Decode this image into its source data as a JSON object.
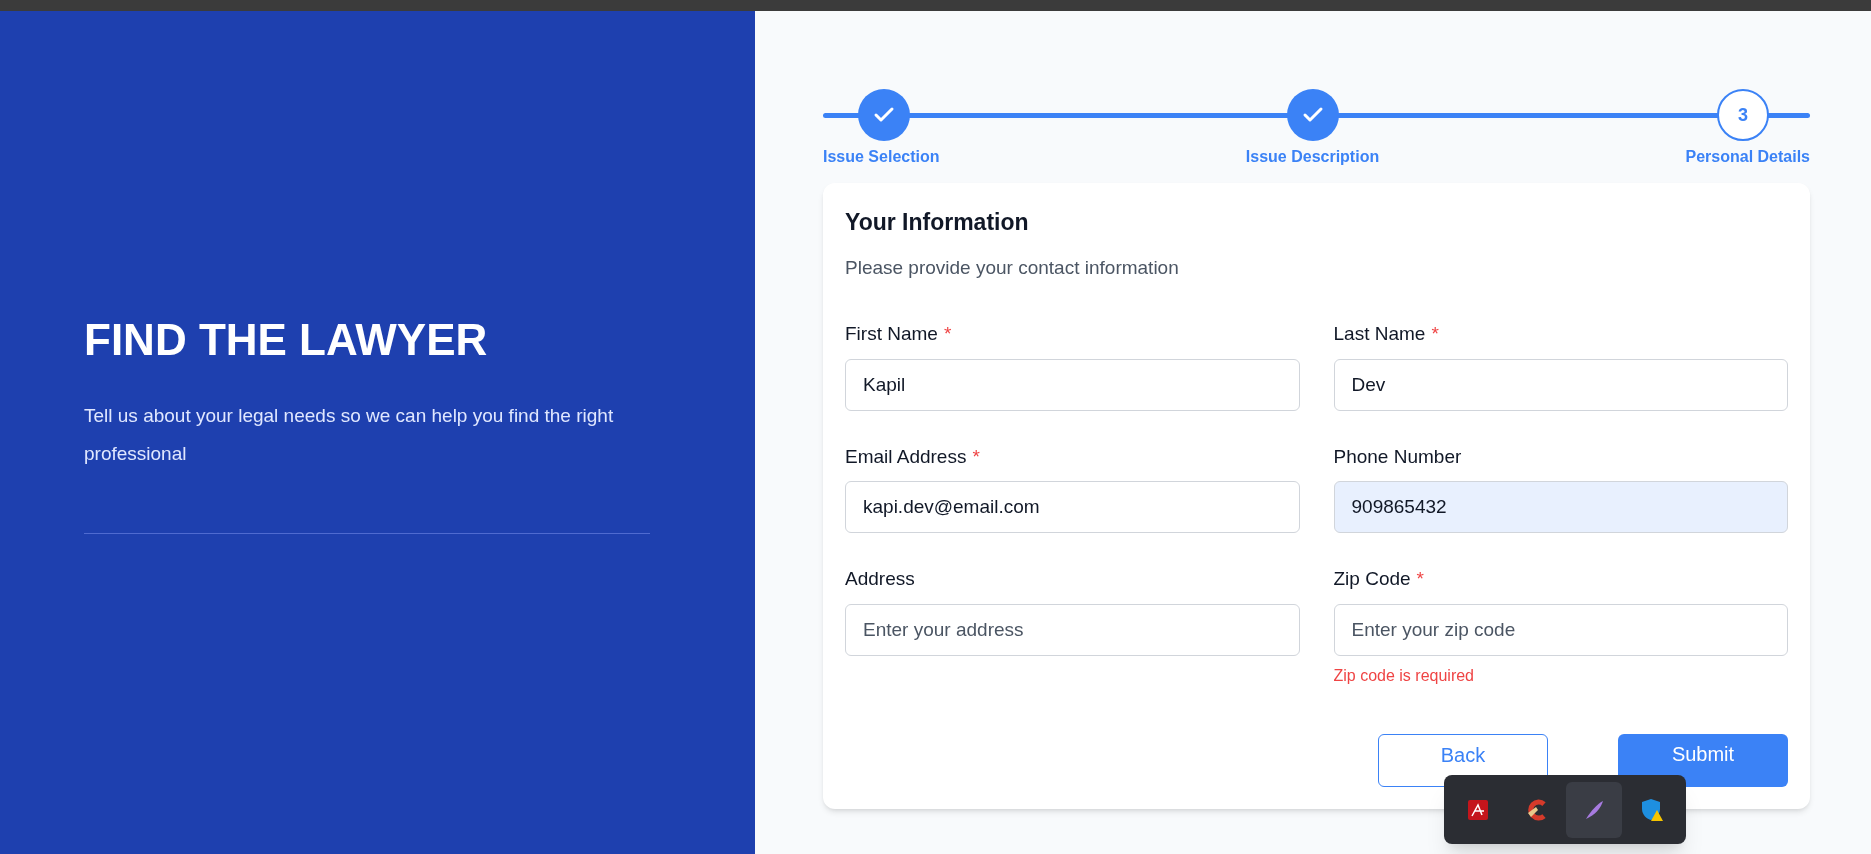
{
  "hero": {
    "title": "FIND THE LAWYER",
    "subtitle": "Tell us about your legal needs so we can help you find the right professional"
  },
  "steps": [
    {
      "label": "Issue Selection",
      "completed": true
    },
    {
      "label": "Issue Description",
      "completed": true
    },
    {
      "label": "Personal Details",
      "completed": false,
      "number": "3"
    }
  ],
  "form": {
    "title": "Your Information",
    "description": "Please provide your contact information",
    "fields": [
      {
        "label": "First Name",
        "required": true,
        "value": "Kapil",
        "autofilled": false
      },
      {
        "label": "Last Name",
        "required": true,
        "value": "Dev",
        "autofilled": false
      },
      {
        "label": "Email Address",
        "required": true,
        "value": "kapi.dev@email.com",
        "autofilled": false
      },
      {
        "label": "Phone Number",
        "required": false,
        "value": "909865432",
        "autofilled": true
      },
      {
        "label": "Address",
        "required": false,
        "placeholder": "Enter your address",
        "autofilled": false
      },
      {
        "label": "Zip Code",
        "required": true,
        "placeholder": "Enter your zip code",
        "autofilled": false,
        "error": "Zip code is required"
      }
    ],
    "required_mark": "*",
    "buttons": [
      {
        "label": "Back",
        "kind": "secondary"
      },
      {
        "label": "Submit",
        "kind": "primary"
      }
    ]
  },
  "tray_popup": {
    "icons": [
      {
        "kind": "pdf",
        "selected": false
      },
      {
        "kind": "cleaner",
        "selected": false
      },
      {
        "kind": "feather",
        "selected": true
      },
      {
        "kind": "shield",
        "selected": false
      }
    ]
  }
}
